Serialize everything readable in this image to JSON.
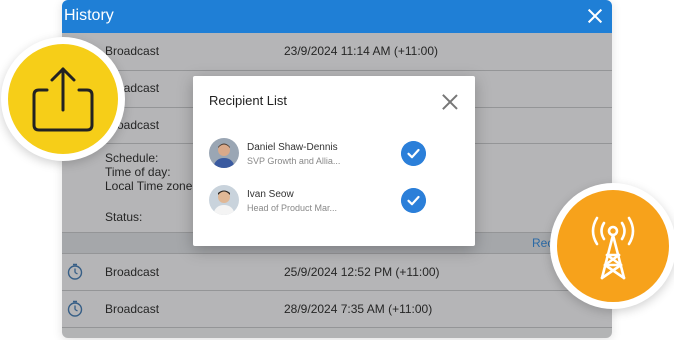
{
  "window": {
    "title": "History"
  },
  "rows": [
    {
      "type": "Broadcast",
      "date": "23/9/2024 11:14 AM (+11:00)"
    },
    {
      "type": "Broadcast",
      "date": ""
    },
    {
      "type": "Broadcast",
      "date": ""
    }
  ],
  "detail": {
    "schedule_label": "Schedule:",
    "time_of_day_label": "Time of day:",
    "local_time_zone_label": "Local Time zone:",
    "status_label": "Status:",
    "recipients_link": "Recipients"
  },
  "rows_after": [
    {
      "type": "Broadcast",
      "date": "25/9/2024 12:52 PM (+11:00)",
      "icon": "clock-icon"
    },
    {
      "type": "Broadcast",
      "date": "28/9/2024 7:35 AM (+11:00)",
      "icon": "clock-icon"
    }
  ],
  "modal": {
    "title": "Recipient List",
    "recipients": [
      {
        "name": "Daniel Shaw-Dennis",
        "role": "SVP Growth and Allia...",
        "checked": true
      },
      {
        "name": "Ivan Seow",
        "role": "Head of Product Mar...",
        "checked": true
      }
    ]
  },
  "decor": {
    "upload_badge": {
      "icon": "upload-icon",
      "color": "#f6ce18"
    },
    "tower_badge": {
      "icon": "broadcast-tower-icon",
      "color": "#f7a21b"
    }
  },
  "colors": {
    "titlebar": "#1f7fd6",
    "check": "#2b7fd9",
    "link": "#3a8fe0"
  }
}
